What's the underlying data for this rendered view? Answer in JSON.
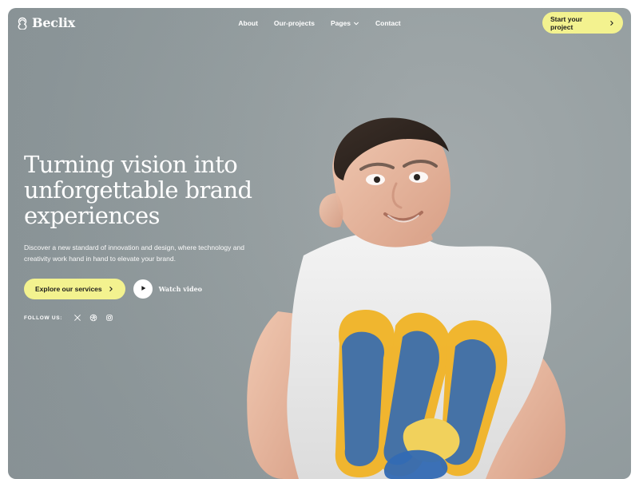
{
  "brand": {
    "name": "Beclix",
    "accent": "#f3f28f"
  },
  "nav": {
    "items": [
      {
        "label": "About"
      },
      {
        "label": "Our-projects"
      },
      {
        "label": "Pages"
      },
      {
        "label": "Contact"
      }
    ],
    "cta_label": "Start your project"
  },
  "hero": {
    "headline_lines": [
      "Turning vision into",
      "unforgettable brand",
      "experiences"
    ],
    "subcopy": "Discover a new standard of innovation and design, where technology and creativity work hand in hand to elevate your brand.",
    "primary_button_label": "Explore our services",
    "watch_label": "Watch video"
  },
  "follow": {
    "label": "FOLLOW US:",
    "icons": [
      "x-icon",
      "dribbble-icon",
      "instagram-icon"
    ]
  },
  "icons": {
    "chevron": "chevron-right-icon",
    "caret": "chevron-down-icon",
    "play": "play-icon"
  }
}
